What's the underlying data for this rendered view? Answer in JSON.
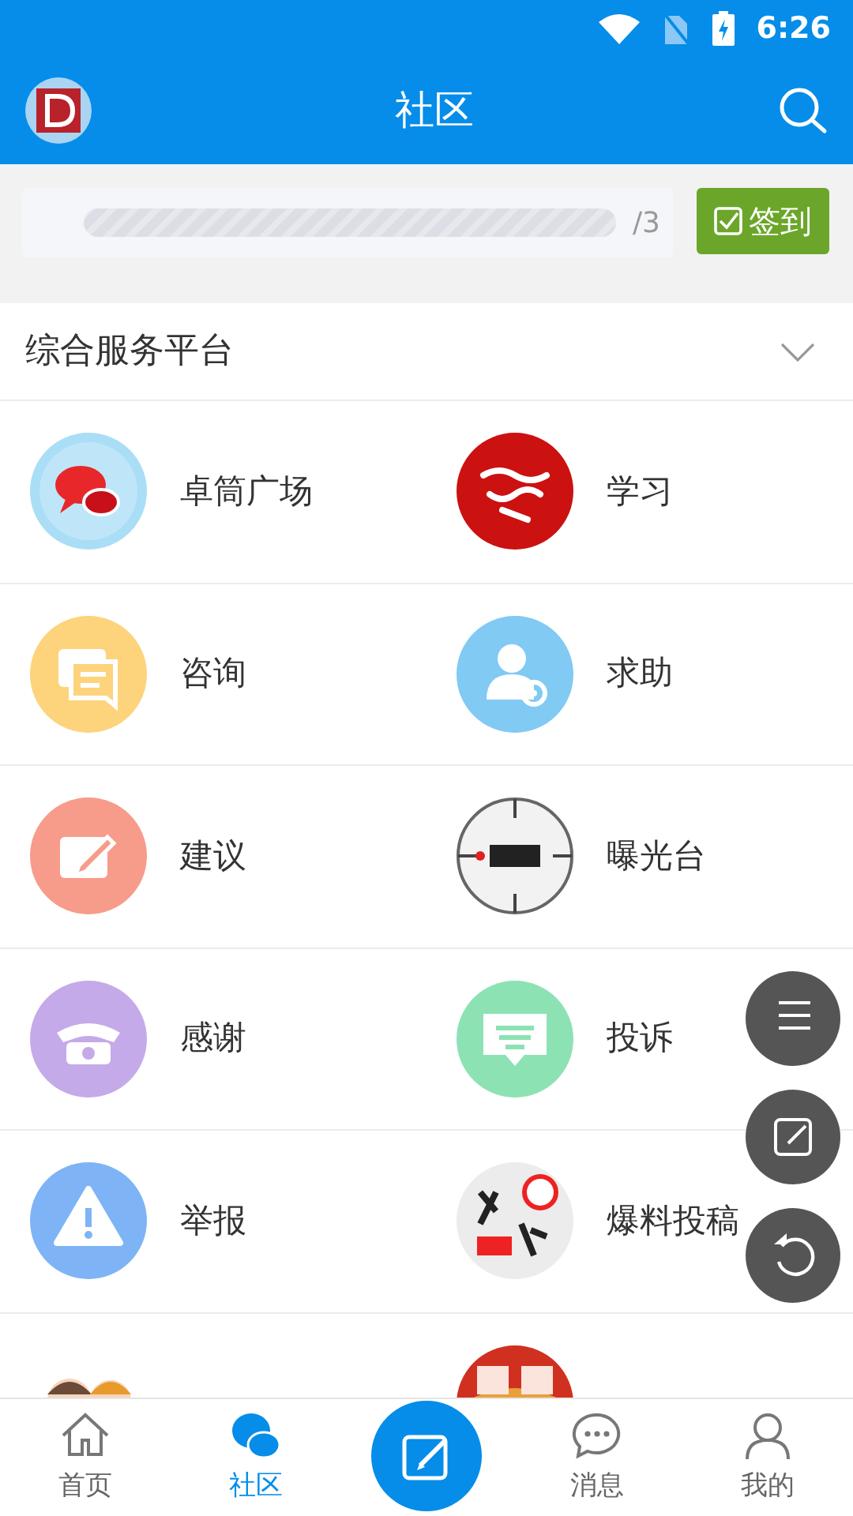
{
  "status_bar": {
    "time": "6:26"
  },
  "app_bar": {
    "title": "社区"
  },
  "checkin": {
    "level": 0,
    "count": "/3",
    "button": "签到"
  },
  "section": {
    "title": "综合服务平台",
    "expanded": false
  },
  "items": [
    {
      "label": "卓筒广场",
      "kind": "bubbles",
      "color": "#a9def6"
    },
    {
      "label": "学习",
      "kind": "study",
      "color": "#cc1111"
    },
    {
      "label": "咨询",
      "kind": "consult",
      "color": "#fdd37c"
    },
    {
      "label": "求助",
      "kind": "help",
      "color": "#80caf3"
    },
    {
      "label": "建议",
      "kind": "suggest",
      "color": "#f79b8b"
    },
    {
      "label": "曝光台",
      "kind": "expose",
      "color": "#f2f2f2"
    },
    {
      "label": "感谢",
      "kind": "thanks",
      "color": "#c5aaea"
    },
    {
      "label": "投诉",
      "kind": "complain",
      "color": "#8de2b3"
    },
    {
      "label": "举报",
      "kind": "report",
      "color": "#7eb4f6"
    },
    {
      "label": "爆料投稿",
      "kind": "tipoff",
      "color": "#ececec"
    },
    {
      "kind": "family"
    },
    {
      "kind": "notice",
      "color": "#d0301f"
    }
  ],
  "fab_menu": [
    {
      "kind": "menu"
    },
    {
      "kind": "edit"
    },
    {
      "kind": "refresh"
    }
  ],
  "tabs": [
    {
      "label": "首页",
      "kind": "home",
      "selected": false
    },
    {
      "label": "社区",
      "kind": "community",
      "selected": true
    },
    {
      "kind": "compose",
      "selected": false
    },
    {
      "label": "消息",
      "kind": "messages",
      "selected": false
    },
    {
      "label": "我的",
      "kind": "profile",
      "selected": false
    }
  ]
}
